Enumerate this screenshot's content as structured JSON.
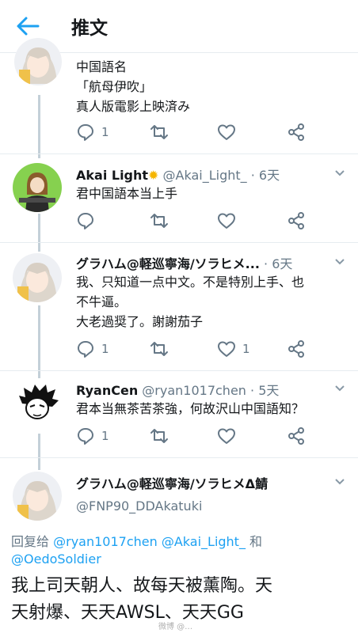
{
  "header": {
    "title": "推文"
  },
  "tweets": [
    {
      "text_lines": [
        "中国語名",
        "「航母伊吹」",
        "真人版電影上映済み"
      ],
      "replies": "1",
      "retweets": "",
      "likes": ""
    },
    {
      "name": "Akai Light",
      "handle": "@Akai_Light_",
      "time": "· 6天",
      "text_lines": [
        "君中国語本当上手"
      ]
    },
    {
      "name": "グラハム@軽巡寧海/ソラヒメ...",
      "time": "· 6天",
      "text_lines": [
        "我、只知道一点中文。不是特別上手、也",
        "不牛逼。",
        "大老過奨了。謝謝茄子"
      ],
      "replies": "1",
      "retweets": "",
      "likes": "1"
    },
    {
      "name": "RyanCen",
      "handle": "@ryan1017chen",
      "time": "· 5天",
      "text_lines": [
        "君本当無茶苦茶強，何故沢山中国語知？"
      ],
      "replies": "1",
      "retweets": "",
      "likes": ""
    }
  ],
  "focused": {
    "name": "グラハム@軽巡寧海/ソラヒメΔ鯖",
    "handle": "@FNP90_DDAkatuki",
    "reply_prefix": "回复给",
    "reply_to_1": "@ryan1017chen",
    "reply_to_2": "@Akai_Light_",
    "reply_and": "和",
    "reply_to_3": "@OedoSoldier",
    "text_lines": [
      "我上司天朝人、故每天被薰陶。天",
      "天射爆、天天AWSL、天天GG"
    ]
  },
  "watermark": "微博 @…",
  "colors": {
    "accent": "#1da1f2",
    "meta": "#657786",
    "border": "#e6ecf0"
  }
}
